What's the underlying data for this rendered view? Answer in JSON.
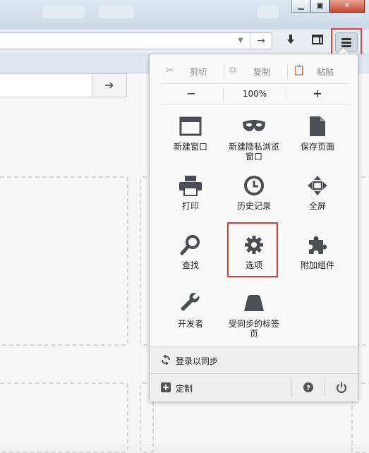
{
  "menu": {
    "edit": {
      "cut": "剪切",
      "copy": "复制",
      "paste": "粘贴"
    },
    "zoom": {
      "minus": "−",
      "value": "100%",
      "plus": "+"
    },
    "items": [
      {
        "label": "新建窗口",
        "icon": "new-window-icon"
      },
      {
        "label": "新建隐私浏览窗口",
        "icon": "private-mask-icon"
      },
      {
        "label": "保存页面",
        "icon": "save-page-icon"
      },
      {
        "label": "打印",
        "icon": "print-icon"
      },
      {
        "label": "历史记录",
        "icon": "history-clock-icon"
      },
      {
        "label": "全屏",
        "icon": "fullscreen-icon"
      },
      {
        "label": "查找",
        "icon": "find-magnifier-icon"
      },
      {
        "label": "选项",
        "icon": "options-gear-icon"
      },
      {
        "label": "附加组件",
        "icon": "addons-puzzle-icon"
      },
      {
        "label": "开发者",
        "icon": "developer-wrench-icon"
      },
      {
        "label": "受同步的标签页",
        "icon": "synced-tabs-icon"
      }
    ],
    "sync": "登录以同步",
    "customize": "定制"
  },
  "colors": {
    "highlight": "#d93b3b",
    "icon": "#4a4f55"
  }
}
